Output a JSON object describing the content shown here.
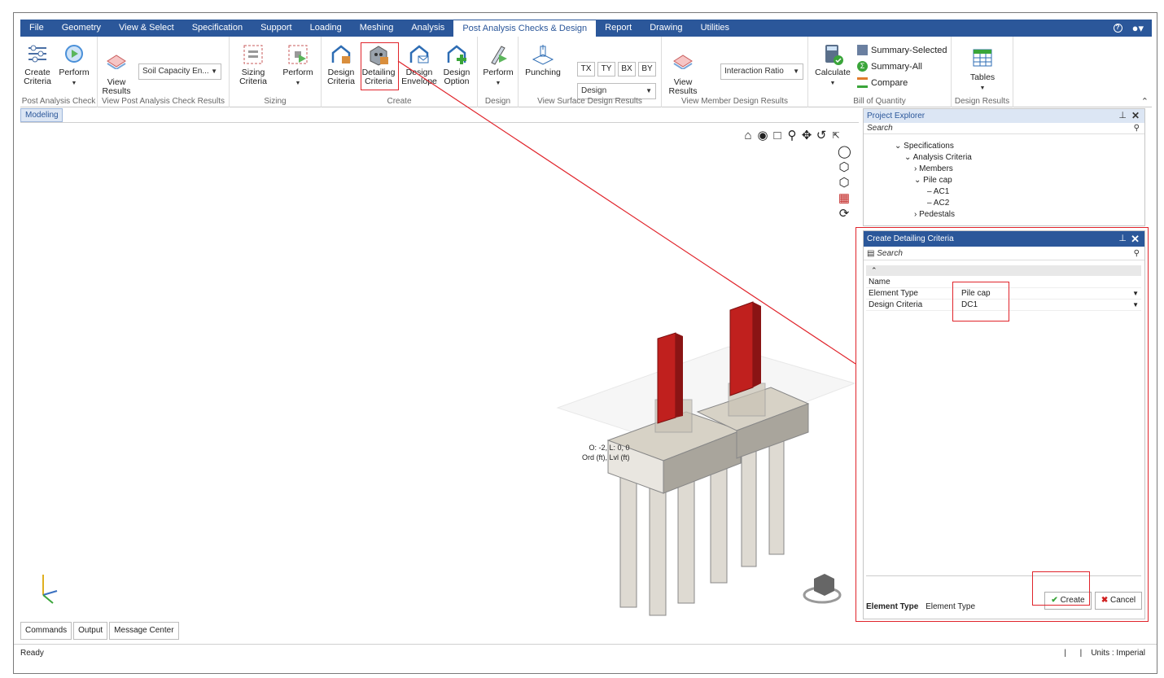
{
  "menu": {
    "tabs": [
      "File",
      "Geometry",
      "View & Select",
      "Specification",
      "Support",
      "Loading",
      "Meshing",
      "Analysis",
      "Post Analysis Checks & Design",
      "Report",
      "Drawing",
      "Utilities"
    ],
    "active_tab": "Post Analysis Checks & Design"
  },
  "ribbon": {
    "create_criteria": "Create\nCriteria",
    "perform": "Perform",
    "view_results": "View\nResults",
    "soil_dropdown": "Soil Capacity En...",
    "sizing_criteria": "Sizing\nCriteria",
    "sizing_perform": "Perform",
    "design_criteria": "Design\nCriteria",
    "detailing_criteria": "Detailing\nCriteria",
    "design_envelope": "Design\nEnvelope",
    "design_option": "Design\nOption",
    "design_perform": "Perform",
    "punching": "Punching",
    "tx": "TX",
    "ty": "TY",
    "bx": "BX",
    "by": "BY",
    "surface_dropdown": "Design",
    "member_view_results": "View\nResults",
    "interaction_dropdown": "Interaction Ratio",
    "calculate": "Calculate",
    "summary_selected": "Summary-Selected",
    "summary_all": "Summary-All",
    "compare": "Compare",
    "tables": "Tables",
    "group_labels": {
      "post_analysis_check": "Post Analysis Check",
      "view_post": "View Post Analysis Check Results",
      "sizing": "Sizing",
      "create": "Create",
      "design": "Design",
      "view_surface": "View Surface Design Results",
      "view_member": "View Member Design Results",
      "boq": "Bill of Quantity",
      "design_results": "Design Results"
    }
  },
  "viewport": {
    "tab": "Modeling",
    "coord_line1": "O: -2, L: 0, 0",
    "coord_line2": "Ord (ft), Lvl (ft)"
  },
  "explorer": {
    "title": "Project Explorer",
    "search_placeholder": "Search",
    "tree": [
      "Specifications",
      "Analysis Criteria",
      "Members",
      "Pile cap",
      "AC1",
      "AC2",
      "Pedestals"
    ]
  },
  "dialog": {
    "title": "Create Detailing Criteria",
    "search_placeholder": "Search",
    "rows": [
      {
        "name": "Name",
        "value": ""
      },
      {
        "name": "Element Type",
        "value": "Pile cap"
      },
      {
        "name": "Design Criteria",
        "value": "DC1"
      }
    ],
    "create": "Create",
    "cancel": "Cancel",
    "footer_label": "Element Type",
    "footer_desc": "Element Type"
  },
  "bottom_tabs": [
    "Commands",
    "Output",
    "Message Center"
  ],
  "status": {
    "left": "Ready",
    "units": "Units : Imperial"
  },
  "colors": {
    "accent": "#2b579a",
    "annotation": "#e0242b",
    "column_red": "#c0201e"
  }
}
